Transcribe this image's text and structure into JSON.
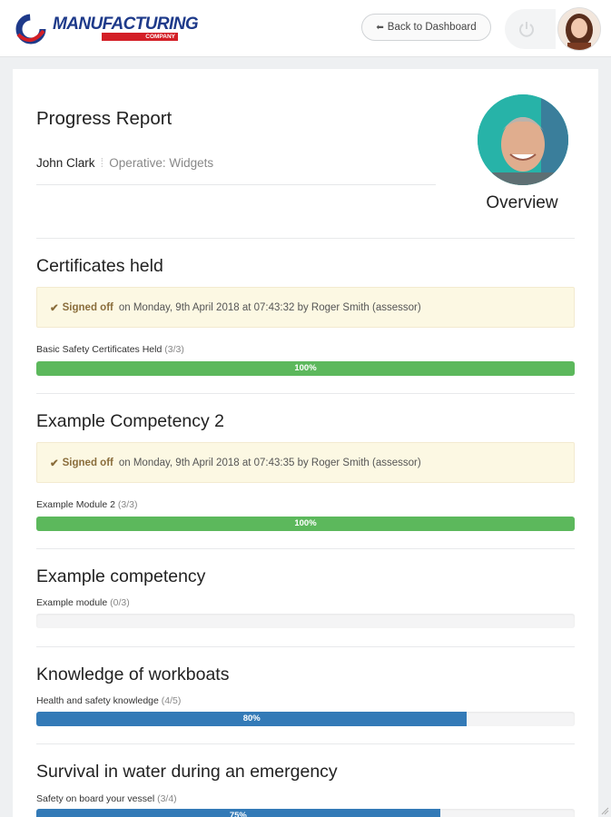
{
  "header": {
    "logo_text": "MANUFACTURING",
    "logo_sub": "COMPANY",
    "back_label": "Back to Dashboard",
    "icons": {
      "back": "arrow-left-icon",
      "power": "power-icon",
      "user_avatar": "avatar"
    }
  },
  "report": {
    "title": "Progress Report",
    "name": "John Clark",
    "role": "Operative: Widgets",
    "overview_label": "Overview"
  },
  "sections": [
    {
      "title": "Certificates held",
      "signed_off": {
        "label": "Signed off",
        "text": "on Monday, 9th April  2018 at 07:43:32 by Roger Smith (assessor)"
      },
      "module": {
        "label": "Basic Safety Certificates Held",
        "count": "(3/3)",
        "percent": 100,
        "percent_text": "100%",
        "color": "#5cb85c"
      }
    },
    {
      "title": "Example Competency 2",
      "signed_off": {
        "label": "Signed off",
        "text": "on Monday, 9th April  2018 at 07:43:35 by Roger Smith (assessor)"
      },
      "module": {
        "label": "Example Module 2",
        "count": "(3/3)",
        "percent": 100,
        "percent_text": "100%",
        "color": "#5cb85c"
      }
    },
    {
      "title": "Example competency",
      "module": {
        "label": "Example module",
        "count": "(0/3)",
        "percent": 0,
        "percent_text": "",
        "color": "#337ab7"
      }
    },
    {
      "title": "Knowledge of workboats",
      "module": {
        "label": "Health and safety knowledge",
        "count": "(4/5)",
        "percent": 80,
        "percent_text": "80%",
        "color": "#337ab7"
      }
    },
    {
      "title": "Survival in water during an emergency",
      "module": {
        "label": "Safety on board your vessel",
        "count": "(3/4)",
        "percent": 75,
        "percent_text": "75%",
        "color": "#337ab7"
      }
    }
  ],
  "colors": {
    "accent_blue": "#337ab7",
    "success_green": "#5cb85c",
    "signoff_bg": "#fcf8e3",
    "brand_blue": "#1e3a8a",
    "brand_red": "#d31f26"
  }
}
